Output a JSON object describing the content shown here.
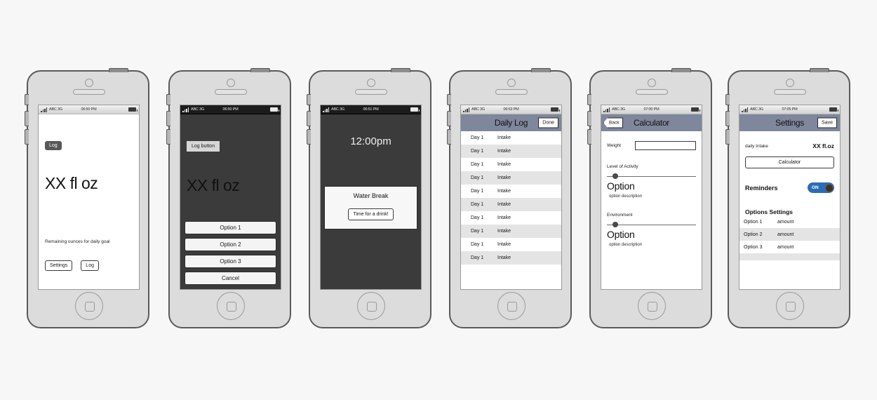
{
  "phones": [
    {
      "id": "home",
      "status": {
        "carrier": "ABC 3G",
        "time": "06:50 PM"
      },
      "log_tag": "Log",
      "amount": "XX fl oz",
      "caption": "Remaining ounces for daily goal",
      "settings_button": "Settings",
      "log_button": "Log"
    },
    {
      "id": "action-sheet",
      "status": {
        "carrier": "ABC 3G",
        "time": "06:50 PM"
      },
      "log_tag": "Log button",
      "amount": "XX fl oz",
      "sheet": [
        "Option 1",
        "Option 2",
        "Option 3",
        "Cancel"
      ]
    },
    {
      "id": "notification",
      "status": {
        "carrier": "ABC 3G",
        "time": "06:51 PM"
      },
      "lock_time": "12:00pm",
      "alert_title": "Water Break",
      "alert_button": "Time for a drink!"
    },
    {
      "id": "daily-log",
      "status": {
        "carrier": "ABC 3G",
        "time": "06:53 PM"
      },
      "nav_title": "Daily Log",
      "nav_right": "Done",
      "rows": [
        {
          "day": "Day 1",
          "intake": "Intake"
        },
        {
          "day": "Day 1",
          "intake": "Intake"
        },
        {
          "day": "Day 1",
          "intake": "Intake"
        },
        {
          "day": "Day 1",
          "intake": "Intake"
        },
        {
          "day": "Day 1",
          "intake": "Intake"
        },
        {
          "day": "Day 1",
          "intake": "Intake"
        },
        {
          "day": "Day 1",
          "intake": "Intake"
        },
        {
          "day": "Day 1",
          "intake": "Intake"
        },
        {
          "day": "Day 1",
          "intake": "Intake"
        },
        {
          "day": "Day 1",
          "intake": "Intake"
        }
      ]
    },
    {
      "id": "calculator",
      "status": {
        "carrier": "ABC 3G",
        "time": "07:00 PM"
      },
      "nav_back": "Back",
      "nav_title": "Calculator",
      "weight_label": "Weight",
      "weight_value": "",
      "sliders": [
        {
          "label": "Level of Activity",
          "option": "Option",
          "description": "option description",
          "value": 8
        },
        {
          "label": "Environment",
          "option": "Option",
          "description": "option description",
          "value": 8
        }
      ]
    },
    {
      "id": "settings",
      "status": {
        "carrier": "ABC 3G",
        "time": "07:05 PM"
      },
      "nav_title": "Settings",
      "nav_right": "Save",
      "daily_intake_label": "daily Intake",
      "daily_intake_value": "XX fl.oz",
      "calculator_button": "Calculator",
      "reminders_label": "Reminders",
      "reminders_state": "ON",
      "options_title": "Options Settings",
      "options": [
        {
          "name": "Option 1",
          "amount": "amount"
        },
        {
          "name": "Option 2",
          "amount": "amount"
        },
        {
          "name": "Option 3",
          "amount": "amount"
        }
      ]
    }
  ],
  "colors": {
    "page_background": "#f7f7f7",
    "phone_body": "#dcdcdc",
    "phone_outline": "#5a5a5a",
    "screen_dark": "#3b3b3b",
    "navbar": "#7e879b",
    "toggle_on": "#2b6cb8",
    "row_stripe": "#e4e4e4",
    "tag_dark": "#585858"
  }
}
